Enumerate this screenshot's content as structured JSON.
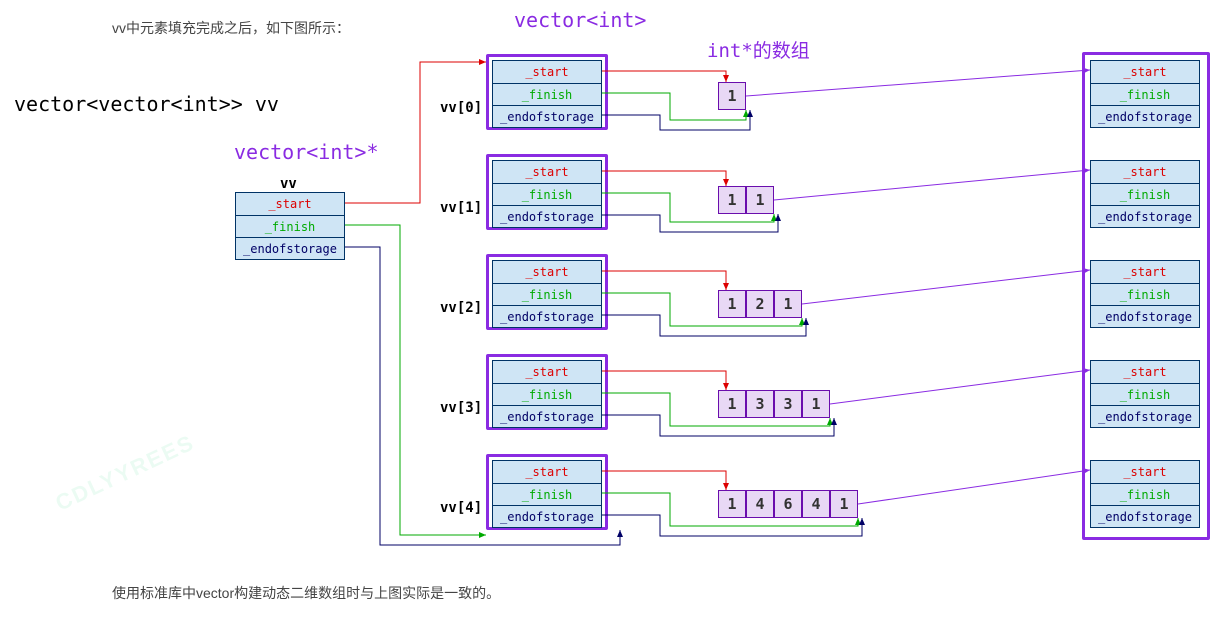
{
  "texts": {
    "top_note": "vv中元素填充完成之后，如下图所示：",
    "title_vvint": "vector<vector<int>> vv",
    "vint": "vector<int>",
    "vintptr": "vector<int>*",
    "intarr": "int*的数组",
    "vv_title": "vv",
    "bottom_note": "使用标准库中vector构建动态二维数组时与上图实际是一致的。",
    "watermark": "CDLYYREES"
  },
  "fields": {
    "start": "_start",
    "finish": "_finish",
    "end": "_endofstorage"
  },
  "rows": [
    {
      "name": "vv[0]",
      "values": [
        "1"
      ]
    },
    {
      "name": "vv[1]",
      "values": [
        "1",
        "1"
      ]
    },
    {
      "name": "vv[2]",
      "values": [
        "1",
        "2",
        "1"
      ]
    },
    {
      "name": "vv[3]",
      "values": [
        "1",
        "3",
        "3",
        "1"
      ]
    },
    {
      "name": "vv[4]",
      "values": [
        "1",
        "4",
        "6",
        "4",
        "1"
      ]
    }
  ]
}
